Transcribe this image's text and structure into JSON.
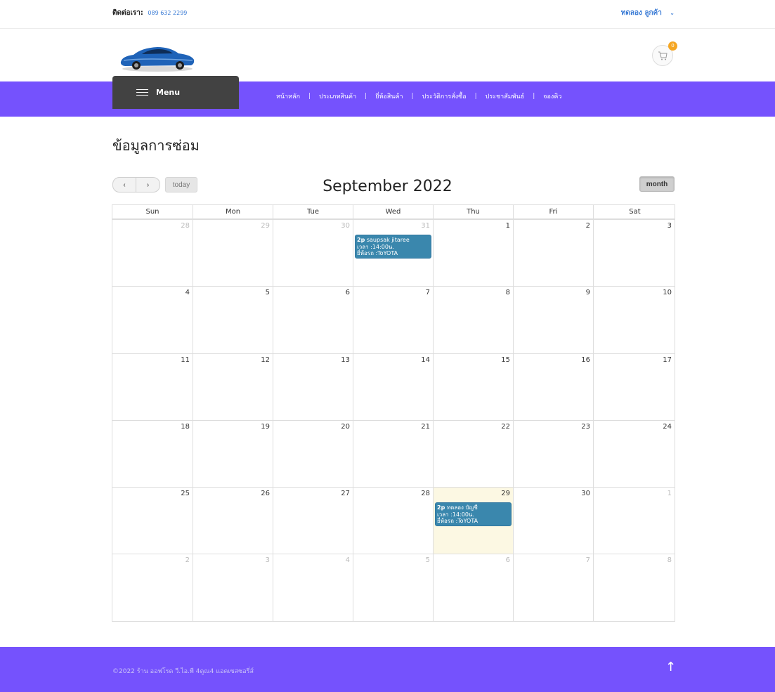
{
  "topbar": {
    "contact_label": "ติดต่อเรา:",
    "phone": "089 632 2299",
    "account_name": "ทดลอง ลูกค้า",
    "account_chevron": "⌄"
  },
  "header": {
    "logo_icon": "car-logo",
    "cart_icon": "shopping-cart-icon",
    "cart_count": "0"
  },
  "nav": {
    "menu_label": "Menu",
    "links": [
      "หน้าหลัก",
      "ประเภทสินค้า",
      "ยี่ห้อสินค้า",
      "ประวัติการสั่งซื้อ",
      "ประชาสัมพันธ์",
      "จองคิว"
    ],
    "separator": "|"
  },
  "page": {
    "title": "ข้อมูลการซ่อม"
  },
  "calendar": {
    "prev_label": "‹",
    "next_label": "›",
    "today_label": "today",
    "title": "September 2022",
    "view_label": "month",
    "days_of_week": [
      "Sun",
      "Mon",
      "Tue",
      "Wed",
      "Thu",
      "Fri",
      "Sat"
    ],
    "weeks": [
      [
        {
          "n": "28",
          "other": true
        },
        {
          "n": "29",
          "other": true
        },
        {
          "n": "30",
          "other": true
        },
        {
          "n": "31",
          "other": true
        },
        {
          "n": "1"
        },
        {
          "n": "2"
        },
        {
          "n": "3"
        }
      ],
      [
        {
          "n": "4"
        },
        {
          "n": "5"
        },
        {
          "n": "6"
        },
        {
          "n": "7"
        },
        {
          "n": "8"
        },
        {
          "n": "9"
        },
        {
          "n": "10"
        }
      ],
      [
        {
          "n": "11"
        },
        {
          "n": "12"
        },
        {
          "n": "13"
        },
        {
          "n": "14"
        },
        {
          "n": "15"
        },
        {
          "n": "16"
        },
        {
          "n": "17"
        }
      ],
      [
        {
          "n": "18"
        },
        {
          "n": "19"
        },
        {
          "n": "20"
        },
        {
          "n": "21"
        },
        {
          "n": "22"
        },
        {
          "n": "23"
        },
        {
          "n": "24"
        }
      ],
      [
        {
          "n": "25"
        },
        {
          "n": "26"
        },
        {
          "n": "27"
        },
        {
          "n": "28"
        },
        {
          "n": "29",
          "today": true
        },
        {
          "n": "30"
        },
        {
          "n": "1",
          "other": true
        }
      ],
      [
        {
          "n": "2",
          "other": true
        },
        {
          "n": "3",
          "other": true
        },
        {
          "n": "4",
          "other": true
        },
        {
          "n": "5",
          "other": true
        },
        {
          "n": "6",
          "other": true
        },
        {
          "n": "7",
          "other": true
        },
        {
          "n": "8",
          "other": true
        }
      ]
    ],
    "events": [
      {
        "week": 0,
        "day": 3,
        "time": "2p",
        "name": "saupsak jitaree",
        "line2": "เวลา :14:00น.",
        "line3": "ยี่ห้อรถ :ToYOTA"
      },
      {
        "week": 4,
        "day": 4,
        "time": "2p",
        "name": "ทดลอง บัญชี",
        "line2": "เวลา :14:00น.",
        "line3": "ยี่ห้อรถ :ToYOTA"
      }
    ],
    "colors": {
      "event": "#3a87ad",
      "today_bg": "#fcf8e3"
    }
  },
  "footer": {
    "copyright": "©2022 ร้าน ออฟโรด วี.ไอ.พี 4ดูณ4 แอคเซสซอรี่ส์",
    "back_to_top": "↑"
  },
  "colors": {
    "brand": "#7552fd",
    "link": "#3a7bd5"
  }
}
